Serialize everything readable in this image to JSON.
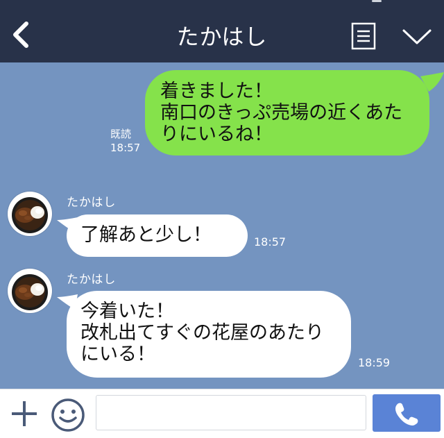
{
  "header": {
    "title": "たかはし"
  },
  "messages": [
    {
      "text": "着きました！\n南口のきっぷ売場の近くあたりにいるね！",
      "read": "既読",
      "time": "18:57"
    },
    {
      "sender": "たかはし",
      "text": "了解あと少し！",
      "time": "18:57"
    },
    {
      "sender": "たかはし",
      "text": "今着いた！\n改札出てすぐの花屋のあたりにいる！",
      "time": "18:59"
    }
  ],
  "footer": {
    "input_placeholder": ""
  },
  "colors": {
    "header_bg": "#283249",
    "chat_bg": "#7494c0",
    "my_bubble": "#85e24b",
    "other_bubble": "#ffffff",
    "call_button": "#5a83d6",
    "footer_icon": "#4a5a78"
  },
  "icons": [
    "back-chevron-icon",
    "menu-list-icon",
    "chevron-down-icon",
    "plus-icon",
    "smile-icon",
    "phone-icon",
    "curry-rice-avatar"
  ]
}
